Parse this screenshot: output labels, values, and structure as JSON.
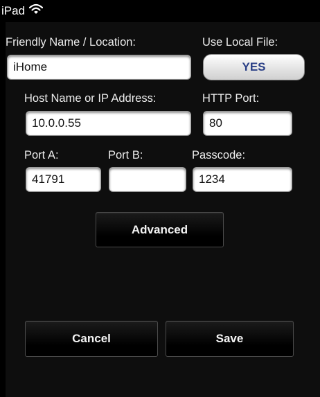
{
  "status_bar": {
    "device": "iPad",
    "wifi_icon": "wifi-icon"
  },
  "form": {
    "friendly_name": {
      "label": "Friendly Name / Location:",
      "value": "iHome"
    },
    "use_local_file": {
      "label": "Use Local File:",
      "value": "YES"
    },
    "host": {
      "label": "Host Name or IP Address:",
      "value": "10.0.0.55"
    },
    "http_port": {
      "label": "HTTP Port:",
      "value": "80"
    },
    "port_a": {
      "label": "Port A:",
      "value": "41791"
    },
    "port_b": {
      "label": "Port B:",
      "value": ""
    },
    "passcode": {
      "label": "Passcode:",
      "value": "1234"
    }
  },
  "buttons": {
    "advanced": "Advanced",
    "cancel": "Cancel",
    "save": "Save"
  },
  "colors": {
    "background": "#000000",
    "field_bg": "#ffffff",
    "toggle_text": "#2a3f86",
    "label_text": "#ececec"
  }
}
